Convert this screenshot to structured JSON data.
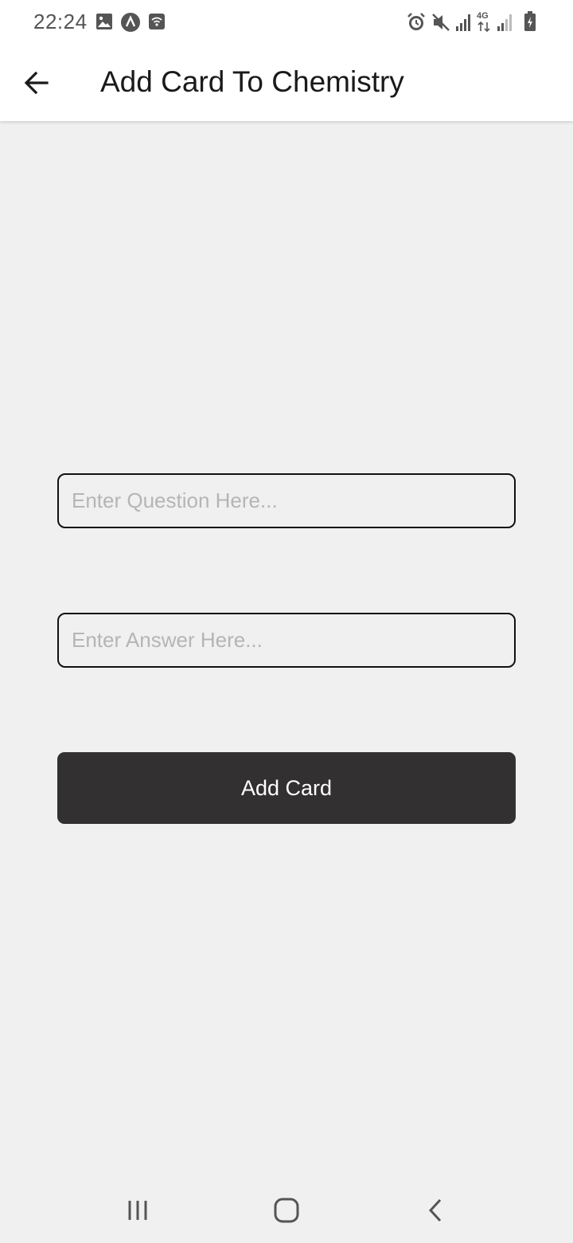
{
  "status_bar": {
    "time": "22:24",
    "left_icons": [
      "image-icon",
      "app-a-icon",
      "wifi-box-icon"
    ],
    "right_icons": [
      "alarm-icon",
      "mute-icon",
      "signal-icon",
      "4g-data-icon",
      "signal-weak-icon",
      "battery-charging-icon"
    ],
    "network_label": "4G"
  },
  "app_bar": {
    "title": "Add Card To Chemistry",
    "back_icon": "arrow-left-icon"
  },
  "form": {
    "question": {
      "value": "",
      "placeholder": "Enter Question Here..."
    },
    "answer": {
      "value": "",
      "placeholder": "Enter Answer Here..."
    },
    "submit_label": "Add Card"
  },
  "nav_bar": {
    "icons": [
      "recents-icon",
      "home-icon",
      "back-chevron-icon"
    ]
  },
  "colors": {
    "background": "#f0f0f0",
    "app_bar": "#ffffff",
    "button": "#333031",
    "button_text": "#ffffff",
    "field_border": "#111111",
    "placeholder": "#b5b5b5"
  }
}
